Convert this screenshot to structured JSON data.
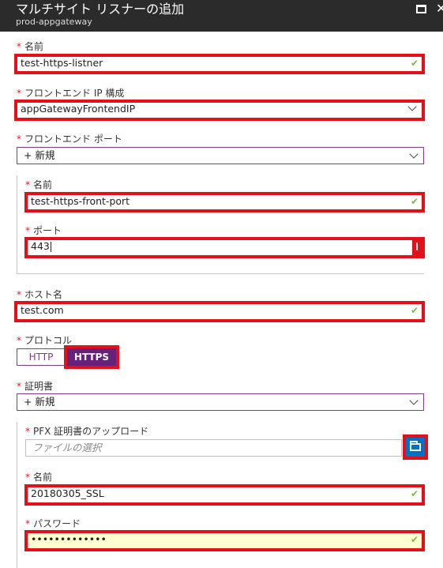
{
  "header": {
    "title": "マルチサイト リスナーの追加",
    "subtitle": "prod-appgateway"
  },
  "required_mark": "*",
  "fields": {
    "name": {
      "label": "名前",
      "value": "test-https-listner"
    },
    "frontend_ip": {
      "label": "フロントエンド IP 構成",
      "value": "appGatewayFrontendIP"
    },
    "frontend_port": {
      "label": "フロントエンド ポート",
      "value": "+ 新規"
    },
    "port_name": {
      "label": "名前",
      "value": "test-https-front-port"
    },
    "port": {
      "label": "ポート",
      "value": "443"
    },
    "host_name": {
      "label": "ホスト名",
      "value": "test.com"
    },
    "protocol": {
      "label": "プロトコル",
      "options": [
        "HTTP",
        "HTTPS"
      ],
      "selected": "HTTPS"
    },
    "certificate": {
      "label": "証明書",
      "value": "+ 新規"
    },
    "pfx_upload": {
      "label": "PFX 証明書のアップロード",
      "placeholder": "ファイルの選択"
    },
    "cert_name": {
      "label": "名前",
      "value": "20180305_SSL"
    },
    "password": {
      "label": "パスワード",
      "value": "•••••••••••••"
    }
  },
  "icons": {
    "valid": "check-icon",
    "select": "chevron-down-icon",
    "browse": "folder-icon"
  },
  "colors": {
    "highlight": "#e3101a",
    "accent": "#68217a",
    "valid": "#7ab648",
    "browse": "#0072c6"
  }
}
